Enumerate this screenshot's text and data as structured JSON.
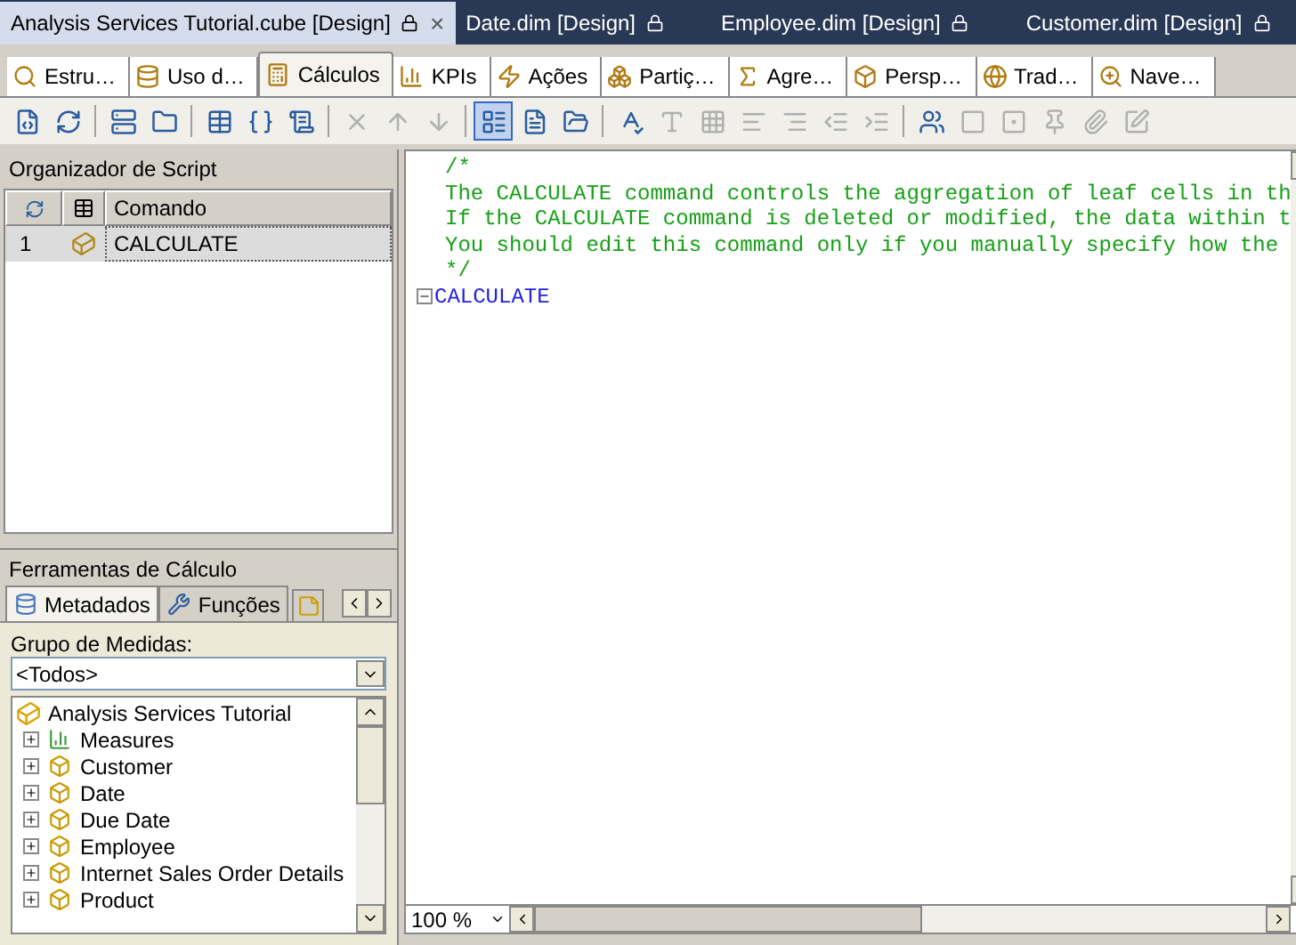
{
  "document_tabs": [
    {
      "label": "Analysis Services Tutorial.cube [Design]",
      "selected": true,
      "close": "×"
    },
    {
      "label": "Date.dim [Design]",
      "selected": false
    },
    {
      "label": "Employee.dim [Design]",
      "selected": false
    },
    {
      "label": "Customer.dim [Design]",
      "selected": false
    }
  ],
  "designer_tabs": [
    {
      "label": "Estru…",
      "selected": false
    },
    {
      "label": "Uso d…",
      "selected": false
    },
    {
      "label": "Cálculos",
      "selected": true
    },
    {
      "label": "KPIs",
      "selected": false
    },
    {
      "label": "Ações",
      "selected": false
    },
    {
      "label": "Partiç…",
      "selected": false
    },
    {
      "label": "Agre…",
      "selected": false
    },
    {
      "label": "Persp…",
      "selected": false
    },
    {
      "label": "Trad…",
      "selected": false
    },
    {
      "label": "Nave…",
      "selected": false
    }
  ],
  "toolbar": [
    {
      "kind": "button",
      "disabled": false,
      "selected": false
    },
    {
      "kind": "button",
      "disabled": false,
      "selected": false
    },
    {
      "kind": "separator"
    },
    {
      "kind": "button",
      "disabled": false,
      "selected": false
    },
    {
      "kind": "button",
      "disabled": false,
      "selected": false
    },
    {
      "kind": "separator"
    },
    {
      "kind": "button",
      "disabled": false,
      "selected": false
    },
    {
      "kind": "button",
      "disabled": false,
      "selected": false
    },
    {
      "kind": "button",
      "disabled": false,
      "selected": false
    },
    {
      "kind": "separator"
    },
    {
      "kind": "button",
      "disabled": true,
      "selected": false
    },
    {
      "kind": "button",
      "disabled": true,
      "selected": false
    },
    {
      "kind": "button",
      "disabled": true,
      "selected": false
    },
    {
      "kind": "separator"
    },
    {
      "kind": "button",
      "disabled": false,
      "selected": true
    },
    {
      "kind": "button",
      "disabled": false,
      "selected": false
    },
    {
      "kind": "button",
      "disabled": false,
      "selected": false
    },
    {
      "kind": "separator"
    },
    {
      "kind": "button",
      "disabled": false,
      "selected": false
    },
    {
      "kind": "button",
      "disabled": true,
      "selected": false
    },
    {
      "kind": "button",
      "disabled": true,
      "selected": false
    },
    {
      "kind": "button",
      "disabled": true,
      "selected": false
    },
    {
      "kind": "button",
      "disabled": true,
      "selected": false
    },
    {
      "kind": "button",
      "disabled": true,
      "selected": false
    },
    {
      "kind": "button",
      "disabled": true,
      "selected": false
    },
    {
      "kind": "separator"
    },
    {
      "kind": "button",
      "disabled": false,
      "selected": false
    },
    {
      "kind": "button",
      "disabled": true,
      "selected": false
    },
    {
      "kind": "button",
      "disabled": true,
      "selected": false
    },
    {
      "kind": "button",
      "disabled": true,
      "selected": false
    },
    {
      "kind": "button",
      "disabled": true,
      "selected": false
    },
    {
      "kind": "button",
      "disabled": true,
      "selected": false
    }
  ],
  "script_organizer": {
    "title": "Organizador de Script",
    "columns": [
      "Comando"
    ],
    "rows": [
      {
        "number": "1",
        "command": "CALCULATE",
        "selected": true
      }
    ]
  },
  "calculation_tools": {
    "title": "Ferramentas de Cálculo",
    "tabs": [
      {
        "label": "Metadados",
        "selected": true
      },
      {
        "label": "Funções",
        "selected": false
      }
    ],
    "measure_group_label": "Grupo de Medidas:",
    "measure_group_value": "<Todos>",
    "tree": {
      "label": "Analysis Services Tutorial",
      "children": [
        {
          "label": "Measures",
          "kind": "measures",
          "expanded": false
        },
        {
          "label": "Customer",
          "kind": "dimension",
          "expanded": false
        },
        {
          "label": "Date",
          "kind": "dimension",
          "expanded": false
        },
        {
          "label": "Due Date",
          "kind": "dimension",
          "expanded": false
        },
        {
          "label": "Employee",
          "kind": "dimension",
          "expanded": false
        },
        {
          "label": "Internet Sales Order Details",
          "kind": "dimension",
          "expanded": false
        },
        {
          "label": "Product",
          "kind": "dimension",
          "expanded": false
        }
      ]
    }
  },
  "editor": {
    "lines": [
      {
        "text": "/*",
        "kind": "comment"
      },
      {
        "text": "The CALCULATE command controls the aggregation of leaf cells in th",
        "kind": "comment"
      },
      {
        "text": "If the CALCULATE command is deleted or modified, the data within t",
        "kind": "comment"
      },
      {
        "text": "You should edit this command only if you manually specify how the",
        "kind": "comment"
      },
      {
        "text": "*/",
        "kind": "comment"
      },
      {
        "text": "CALCULATE",
        "kind": "keyword",
        "collapsible": true
      }
    ],
    "zoom": "100 %"
  }
}
